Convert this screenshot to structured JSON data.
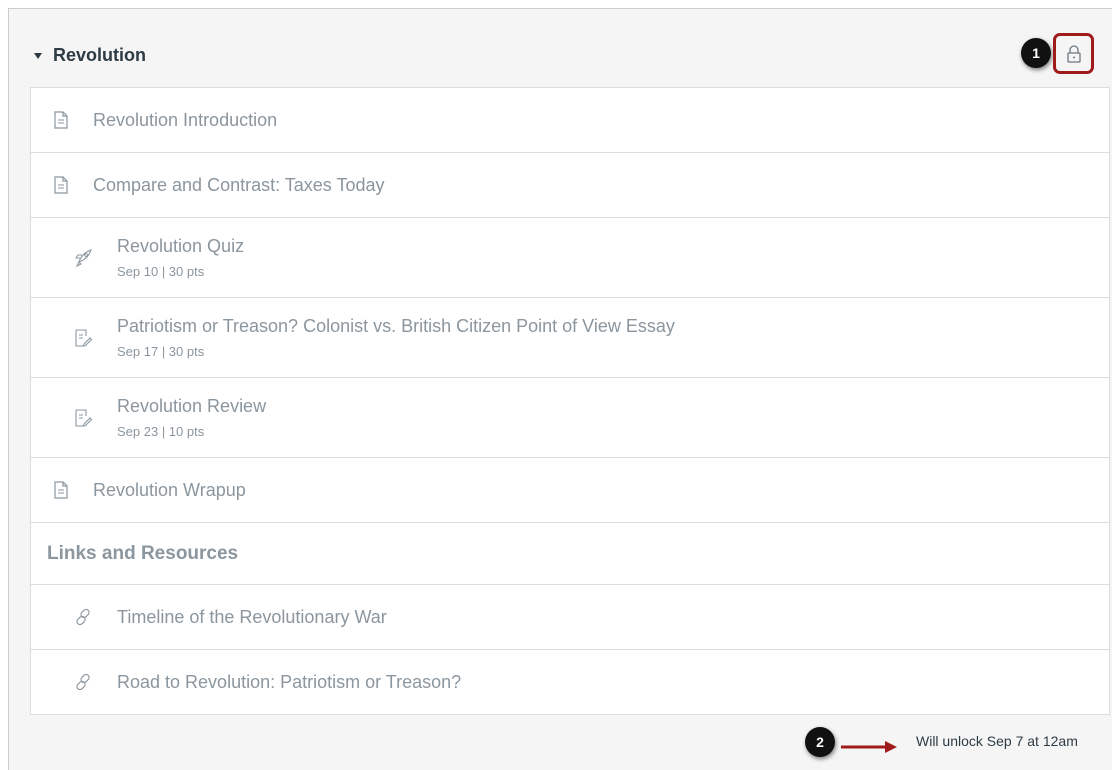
{
  "module": {
    "title": "Revolution",
    "lock_icon": "lock-icon",
    "callouts": [
      "1",
      "2"
    ],
    "items": [
      {
        "type": "page",
        "icon": "document-icon",
        "title": "Revolution Introduction"
      },
      {
        "type": "page",
        "icon": "document-icon",
        "title": "Compare and Contrast: Taxes Today"
      },
      {
        "type": "quiz",
        "icon": "rocket-icon",
        "title": "Revolution Quiz",
        "meta": "Sep 10  |  30 pts"
      },
      {
        "type": "assignment",
        "icon": "assignment-icon",
        "title": "Patriotism or Treason? Colonist vs. British Citizen Point of View Essay",
        "meta": "Sep 17  |  30 pts"
      },
      {
        "type": "assignment",
        "icon": "assignment-icon",
        "title": "Revolution Review",
        "meta": "Sep 23  |  10 pts"
      },
      {
        "type": "page",
        "icon": "document-icon",
        "title": "Revolution Wrapup"
      },
      {
        "type": "header",
        "title": "Links and Resources"
      },
      {
        "type": "link",
        "icon": "link-icon",
        "title": "Timeline of the Revolutionary War"
      },
      {
        "type": "link",
        "icon": "link-icon",
        "title": "Road to Revolution: Patriotism or Treason?"
      }
    ],
    "unlock_text": "Will unlock Sep 7 at 12am"
  },
  "colors": {
    "callout_border": "#a01c1c",
    "muted_text": "#8b969e",
    "arrow": "#a01c1c"
  }
}
